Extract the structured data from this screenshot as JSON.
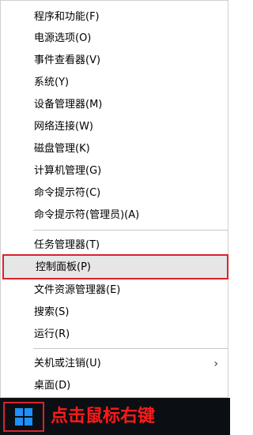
{
  "menu": {
    "items": [
      {
        "label": "程序和功能(F)"
      },
      {
        "label": "电源选项(O)"
      },
      {
        "label": "事件查看器(V)"
      },
      {
        "label": "系统(Y)"
      },
      {
        "label": "设备管理器(M)"
      },
      {
        "label": "网络连接(W)"
      },
      {
        "label": "磁盘管理(K)"
      },
      {
        "label": "计算机管理(G)"
      },
      {
        "label": "命令提示符(C)"
      },
      {
        "label": "命令提示符(管理员)(A)"
      },
      {
        "label": "任务管理器(T)"
      },
      {
        "label": "控制面板(P)"
      },
      {
        "label": "文件资源管理器(E)"
      },
      {
        "label": "搜索(S)"
      },
      {
        "label": "运行(R)"
      },
      {
        "label": "关机或注销(U)"
      },
      {
        "label": "桌面(D)"
      }
    ],
    "submenu_arrow": "›"
  },
  "taskbar": {
    "start_icon": "windows-logo-icon",
    "hint": "点击鼠标右键"
  },
  "colors": {
    "highlight_border": "#d9232d",
    "hint_text": "#ff1a1a",
    "windows_logo": "#1e90ff",
    "taskbar": "#0b0f14"
  }
}
